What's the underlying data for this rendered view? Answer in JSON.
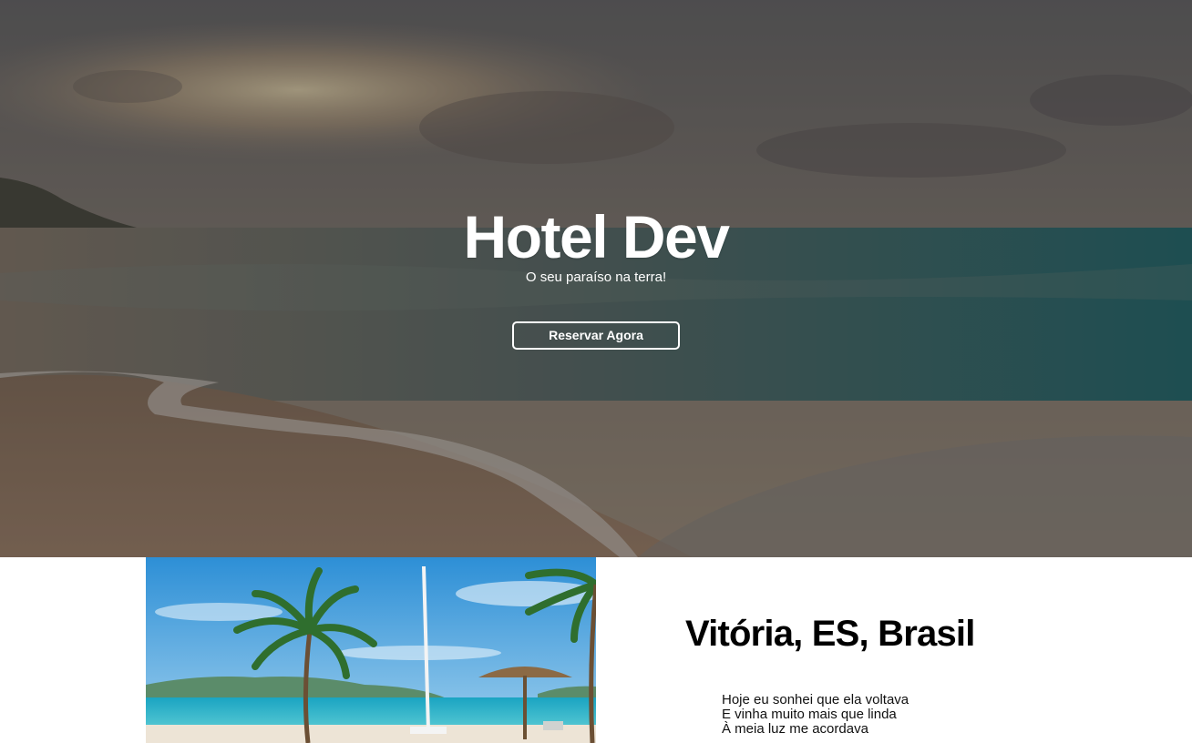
{
  "hero": {
    "title": "Hotel Dev",
    "subtitle": "O seu paraíso na terra!",
    "button_label": "Reservar Agora"
  },
  "about": {
    "title": "Vitória, ES, Brasil",
    "poem_lines": [
      "Hoje eu sonhei que ela voltava",
      "E vinha muito mais que linda",
      "À meia luz me acordava"
    ]
  },
  "colors": {
    "hero_text": "#ffffff",
    "about_title": "#000000"
  }
}
